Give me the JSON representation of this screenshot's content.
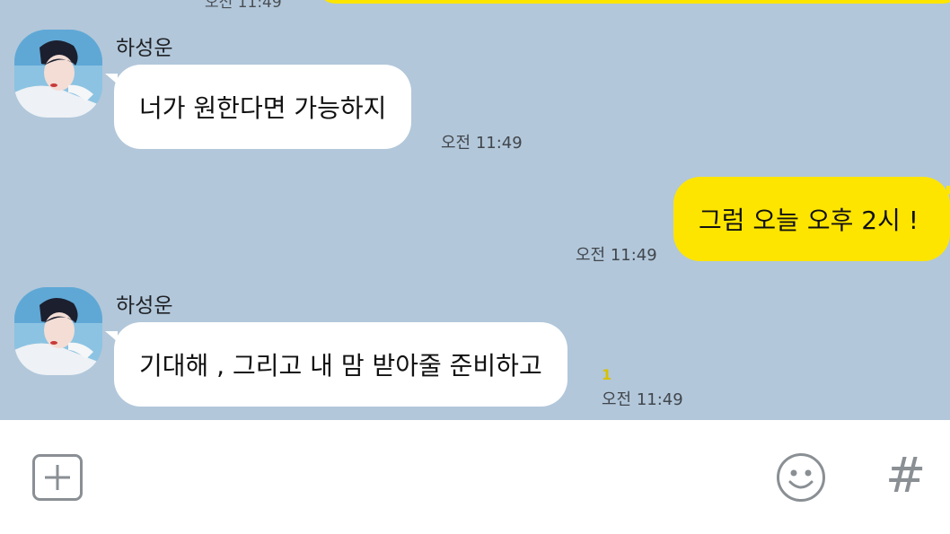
{
  "colors": {
    "chat_background": "#b2c7da",
    "outgoing_bubble": "#fee500",
    "incoming_bubble": "#ffffff",
    "unread_count": "#d8c100",
    "input_background": "#ffffff",
    "icon_gray": "#8a8f94"
  },
  "previous_message": {
    "time": "오전 11:49"
  },
  "messages": [
    {
      "direction": "incoming",
      "sender": "하성운",
      "text": "너가 원한다면 가능하지",
      "time": "오전 11:49"
    },
    {
      "direction": "outgoing",
      "text": "그럼 오늘 오후 2시 !",
      "time": "오전 11:49"
    },
    {
      "direction": "incoming",
      "sender": "하성운",
      "text": "기대해 , 그리고 내 맘 받아줄 준비하고",
      "time": "오전 11:49",
      "unread_count": "1"
    }
  ],
  "input_bar": {
    "icons": [
      "plus-square-icon",
      "smiley-icon",
      "hashtag-icon"
    ],
    "hash_glyph": "#"
  }
}
